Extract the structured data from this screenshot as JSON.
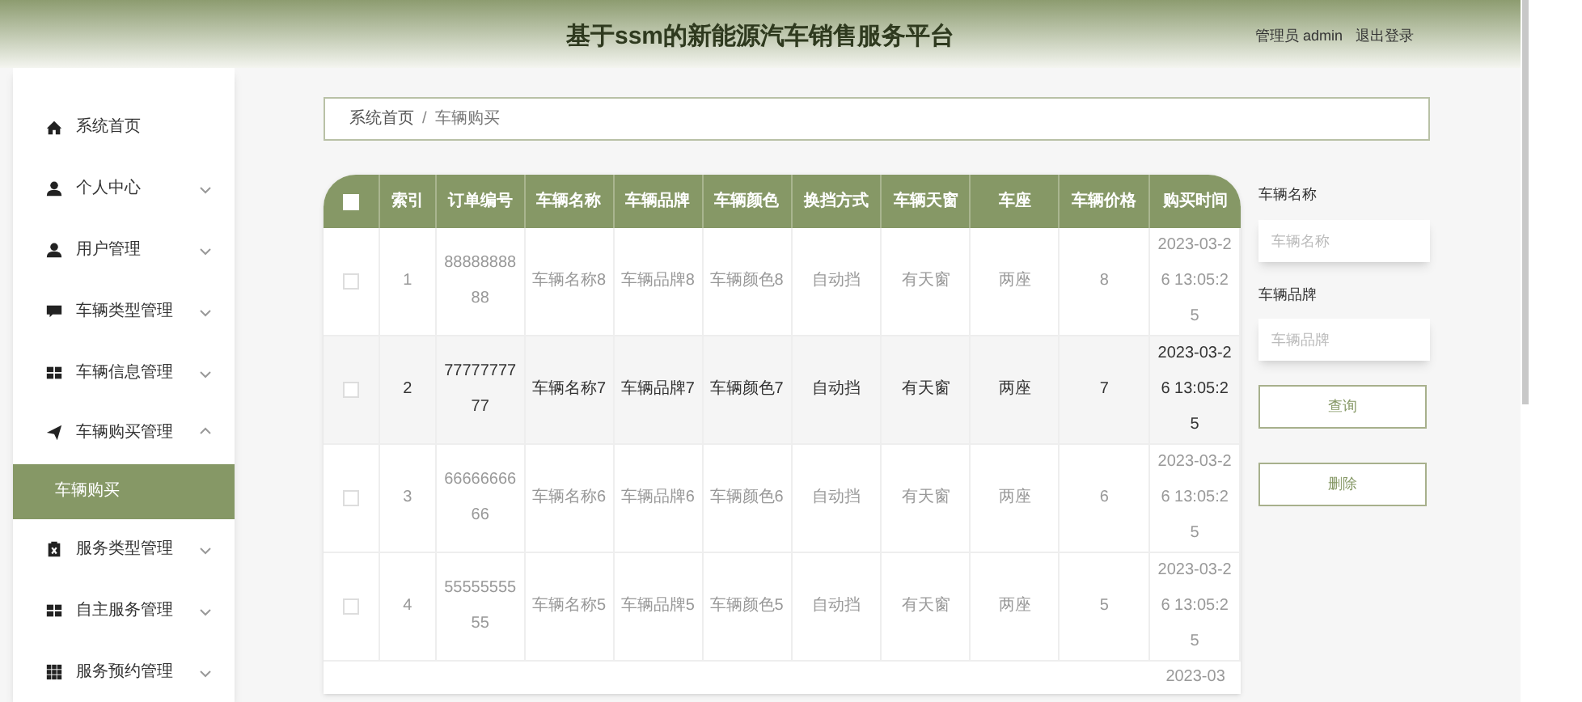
{
  "header": {
    "title": "基于ssm的新能源汽车销售服务平台",
    "user": "管理员 admin",
    "logout": "退出登录"
  },
  "sidebar": {
    "items": [
      {
        "label": "系统首页",
        "kind": "home",
        "selected": false
      },
      {
        "label": "个人中心",
        "kind": "person",
        "expanded": false,
        "selected": false
      },
      {
        "label": "用户管理",
        "kind": "person",
        "expanded": false,
        "selected": false
      },
      {
        "label": "车辆类型管理",
        "kind": "chat",
        "expanded": false,
        "selected": false
      },
      {
        "label": "车辆信息管理",
        "kind": "grid",
        "expanded": false,
        "selected": false
      },
      {
        "label": "车辆购买管理",
        "kind": "plane",
        "expanded": true,
        "selected": false,
        "children": [
          {
            "label": "车辆购买",
            "selected": true
          }
        ]
      },
      {
        "label": "服务类型管理",
        "kind": "clipboard",
        "expanded": false,
        "selected": false
      },
      {
        "label": "自主服务管理",
        "kind": "grid",
        "expanded": false,
        "selected": false
      },
      {
        "label": "服务预约管理",
        "kind": "grid9",
        "expanded": false,
        "selected": false
      }
    ]
  },
  "breadcrumb": {
    "items": [
      "系统首页",
      "车辆购买"
    ],
    "separator": "/"
  },
  "table": {
    "columns": [
      "索引",
      "订单编号",
      "车辆名称",
      "车辆品牌",
      "车辆颜色",
      "换挡方式",
      "车辆天窗",
      "车座",
      "车辆价格",
      "购买时间"
    ],
    "all_checked": false,
    "rows": [
      {
        "checked": false,
        "highlighted": false,
        "cells": [
          "1",
          "8888888888",
          "车辆名称8",
          "车辆品牌8",
          "车辆颜色8",
          "自动挡",
          "有天窗",
          "两座",
          "8",
          "2023-03-26 13:05:25"
        ]
      },
      {
        "checked": false,
        "highlighted": true,
        "cells": [
          "2",
          "7777777777",
          "车辆名称7",
          "车辆品牌7",
          "车辆颜色7",
          "自动挡",
          "有天窗",
          "两座",
          "7",
          "2023-03-26 13:05:25"
        ]
      },
      {
        "checked": false,
        "highlighted": false,
        "cells": [
          "3",
          "6666666666",
          "车辆名称6",
          "车辆品牌6",
          "车辆颜色6",
          "自动挡",
          "有天窗",
          "两座",
          "6",
          "2023-03-26 13:05:25"
        ]
      },
      {
        "checked": false,
        "highlighted": false,
        "cells": [
          "4",
          "5555555555",
          "车辆名称5",
          "车辆品牌5",
          "车辆颜色5",
          "自动挡",
          "有天窗",
          "两座",
          "5",
          "2023-03-26 13:05:25"
        ]
      }
    ],
    "partial_row_time": "2023-03"
  },
  "search": {
    "fields": [
      {
        "label": "车辆名称",
        "placeholder": "车辆名称"
      },
      {
        "label": "车辆品牌",
        "placeholder": "车辆品牌"
      }
    ],
    "buttons": [
      "查询",
      "删除"
    ]
  }
}
